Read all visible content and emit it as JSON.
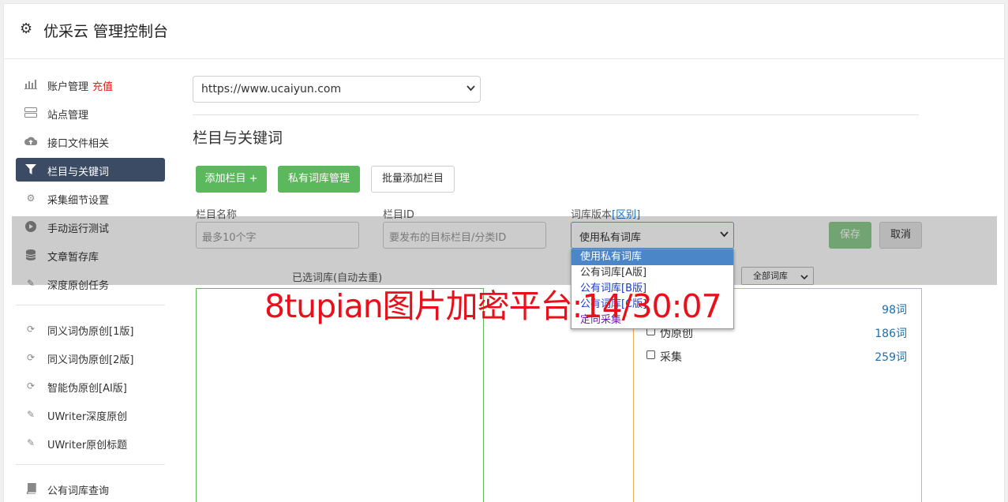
{
  "header": {
    "title": "优采云 管理控制台",
    "icon": "gear-icon"
  },
  "sidebar": {
    "group1": [
      {
        "label": "账户管理",
        "extra": "充值",
        "icon": "bar-chart-icon"
      },
      {
        "label": "站点管理",
        "icon": "server-icon"
      },
      {
        "label": "接口文件相关",
        "icon": "cloud-upload-icon"
      },
      {
        "label": "栏目与关键词",
        "icon": "filter-icon",
        "active": true
      },
      {
        "label": "采集细节设置",
        "icon": "cogs-icon"
      },
      {
        "label": "手动运行测试",
        "icon": "play-circle-icon"
      },
      {
        "label": "文章暂存库",
        "icon": "database-icon"
      },
      {
        "label": "深度原创任务",
        "icon": "edit-icon"
      }
    ],
    "group2": [
      {
        "label": "同义词伪原创[1版]",
        "icon": "refresh-icon"
      },
      {
        "label": "同义词伪原创[2版]",
        "icon": "refresh-icon"
      },
      {
        "label": "智能伪原创[AI版]",
        "icon": "refresh-icon"
      },
      {
        "label": "UWriter深度原创",
        "icon": "edit-icon"
      },
      {
        "label": "UWriter原创标题",
        "icon": "edit-icon"
      }
    ],
    "group3": [
      {
        "label": "公有词库查询",
        "icon": "book-icon"
      }
    ]
  },
  "main": {
    "site_select": "https://www.ucaiyun.com",
    "section_title": "栏目与关键词",
    "buttons": {
      "add_column": "添加栏目 +",
      "private_lib": "私有词库管理",
      "batch_add": "批量添加栏目"
    },
    "form": {
      "name_label": "栏目名称",
      "name_placeholder": "最多10个字",
      "id_label": "栏目ID",
      "id_placeholder": "要发布的目标栏目/分类ID",
      "dict_label": "词库版本",
      "dict_link": "[区别]",
      "dict_value": "使用私有词库",
      "save": "保存",
      "cancel": "取消"
    },
    "selected_label": "已选词库(自动去重)",
    "filter_select": "全部词库",
    "libraries": [
      {
        "name": "伪原创",
        "count": "186词"
      },
      {
        "name": "采集",
        "count": "259词"
      }
    ],
    "partial_count": "98词"
  },
  "dropdown": {
    "options": [
      "使用私有词库",
      "公有词库[A版]",
      "公有词库[B版]",
      "公有词库[C版]",
      "定向采集"
    ]
  },
  "watermark": "8tupian图片加密平台:14/30:07",
  "colors": {
    "primary_green": "#5cb85c",
    "active_nav": "#3c4b64",
    "link_blue": "#1a73c9",
    "watermark_red": "#e8101a"
  }
}
